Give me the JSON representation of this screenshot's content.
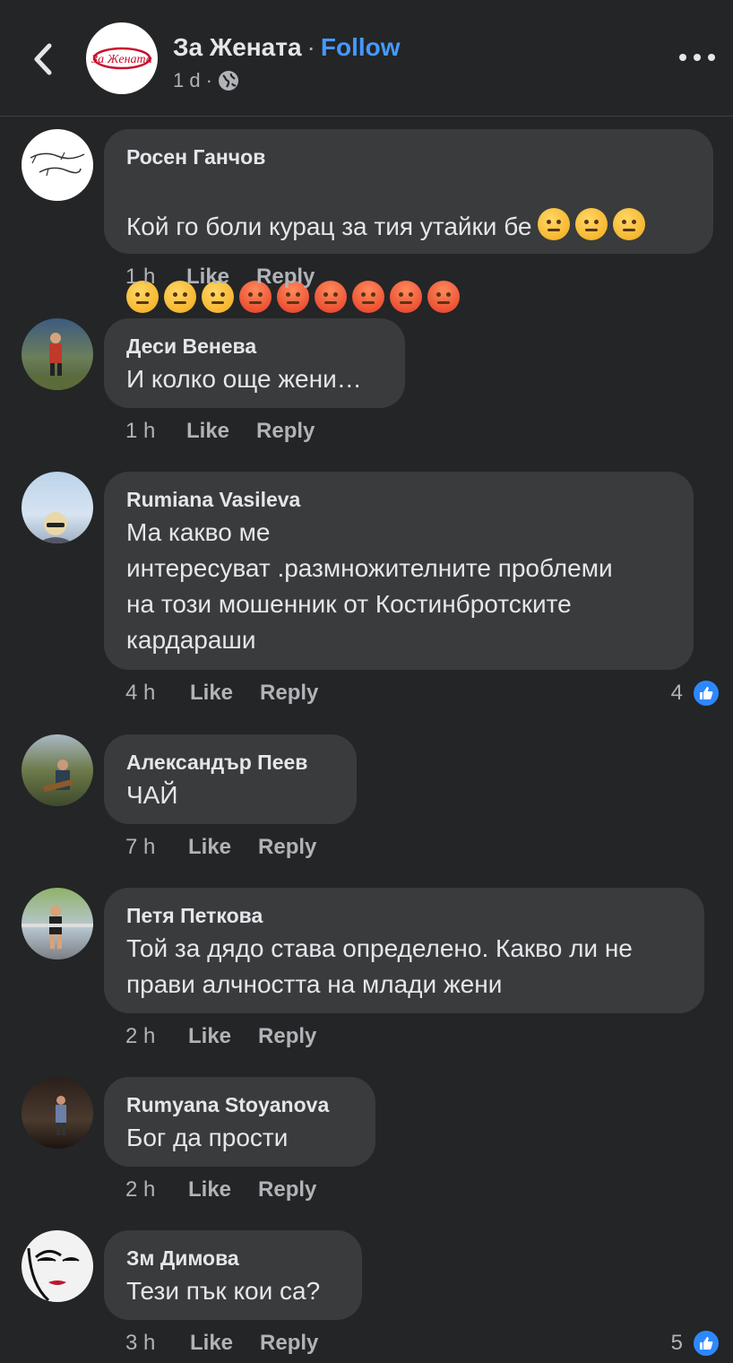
{
  "header": {
    "page_name": "За Жената",
    "separator": "·",
    "follow_label": "Follow",
    "time": "1 d",
    "meta_separator": "·",
    "privacy_icon": "globe-icon",
    "logo_text": "За Жената"
  },
  "comments": [
    {
      "author": "Росен Ганчов",
      "text": "Кой го боли курац за тия утайки бе",
      "emojis_line1": [
        "thinking-face",
        "thinking-face",
        "thinking-face"
      ],
      "emojis_line2": [
        "thinking-face",
        "thinking-face",
        "thinking-face",
        "angry-face",
        "angry-face",
        "angry-face",
        "angry-face",
        "angry-face",
        "angry-face"
      ],
      "time": "1 h",
      "like_label": "Like",
      "reply_label": "Reply"
    },
    {
      "author": "Деси Венева",
      "text": "И колко още жени…",
      "time": "1 h",
      "like_label": "Like",
      "reply_label": "Reply"
    },
    {
      "author": "Rumiana Vasileva",
      "text": "Ма какво ме\nинтересуват .размножителните проблеми\nна този мошенник  от Костинбротските\nкардараши",
      "time": "4 h",
      "like_label": "Like",
      "reply_label": "Reply",
      "reactions": "4"
    },
    {
      "author": "Александър Пеев",
      "text": "ЧАЙ",
      "time": "7 h",
      "like_label": "Like",
      "reply_label": "Reply"
    },
    {
      "author": "Петя Петкова",
      "text": "Той за дядо става определено. Какво ли не\nправи алчността на млади жени",
      "time": "2 h",
      "like_label": "Like",
      "reply_label": "Reply"
    },
    {
      "author": "Rumyana Stoyanova",
      "text": "Бог да прости",
      "time": "2 h",
      "like_label": "Like",
      "reply_label": "Reply"
    },
    {
      "author": "Зм Димова",
      "text": "Тези пък кои са?",
      "time": "3 h",
      "like_label": "Like",
      "reply_label": "Reply",
      "reactions": "5"
    }
  ],
  "colors": {
    "background": "#242526",
    "bubble": "#3a3b3c",
    "follow_link": "#4599ff",
    "like_badge": "#2d88ff"
  }
}
